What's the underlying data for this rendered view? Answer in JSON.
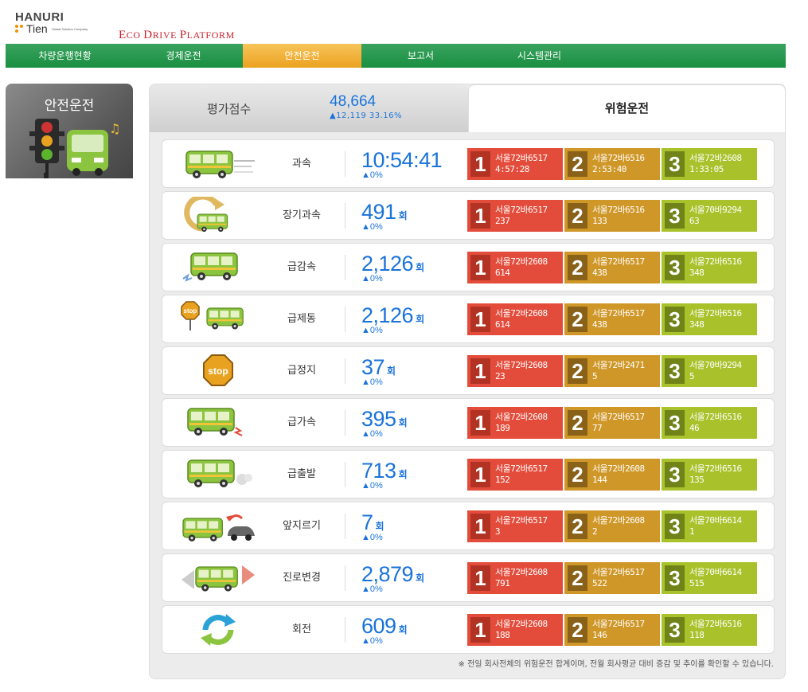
{
  "header": {
    "logo_name": "HANURI",
    "logo_sub": "Tien",
    "logo_tagline": "Global Solution Company",
    "platform_words": [
      {
        "cap": "E",
        "rest": "CO "
      },
      {
        "cap": "D",
        "rest": "RIVE "
      },
      {
        "cap": "P",
        "rest": "LATFORM"
      }
    ]
  },
  "nav": {
    "items": [
      "차량운행현황",
      "경제운전",
      "안전운전",
      "보고서",
      "시스템관리"
    ],
    "active_index": 2
  },
  "sidebar": {
    "title": "안전운전"
  },
  "score_tab": {
    "label": "평가점수",
    "value": "48,664",
    "delta": "▲12,119  33.16%"
  },
  "risk_tab": {
    "label": "위험운전"
  },
  "colors": {
    "accent_blue": "#1a73d9",
    "nav_green": "#198f41",
    "nav_active": "#eba21f",
    "rank1": "#e34c3b",
    "rank2": "#cf9728",
    "rank3": "#a9c12a"
  },
  "rows": [
    {
      "icon": "speeding-bus-icon",
      "name": "과속",
      "value": "10:54:41",
      "unit": "",
      "pct": "▲0%",
      "ranks": [
        {
          "n": "1",
          "plate": "서울72바6517",
          "v": "4:57:28"
        },
        {
          "n": "2",
          "plate": "서울72바6516",
          "v": "2:53:40"
        },
        {
          "n": "3",
          "plate": "서울72바2608",
          "v": "1:33:05"
        }
      ]
    },
    {
      "icon": "long-speeding-bus-icon",
      "name": "장기과속",
      "value": "491",
      "unit": "회",
      "pct": "▲0%",
      "ranks": [
        {
          "n": "1",
          "plate": "서울72바6517",
          "v": "237"
        },
        {
          "n": "2",
          "plate": "서울72바6516",
          "v": "133"
        },
        {
          "n": "3",
          "plate": "서울70바9294",
          "v": "63"
        }
      ]
    },
    {
      "icon": "sudden-decel-bus-icon",
      "name": "급감속",
      "value": "2,126",
      "unit": "회",
      "pct": "▲0%",
      "ranks": [
        {
          "n": "1",
          "plate": "서울72바2608",
          "v": "614"
        },
        {
          "n": "2",
          "plate": "서울72바6517",
          "v": "438"
        },
        {
          "n": "3",
          "plate": "서울72바6516",
          "v": "348"
        }
      ]
    },
    {
      "icon": "sudden-brake-bus-icon",
      "name": "급제동",
      "value": "2,126",
      "unit": "회",
      "pct": "▲0%",
      "ranks": [
        {
          "n": "1",
          "plate": "서울72바2608",
          "v": "614"
        },
        {
          "n": "2",
          "plate": "서울72바6517",
          "v": "438"
        },
        {
          "n": "3",
          "plate": "서울72바6516",
          "v": "348"
        }
      ]
    },
    {
      "icon": "stop-sign-icon",
      "name": "급정지",
      "value": "37",
      "unit": "회",
      "pct": "▲0%",
      "ranks": [
        {
          "n": "1",
          "plate": "서울72바2608",
          "v": "23"
        },
        {
          "n": "2",
          "plate": "서울72바2471",
          "v": "5"
        },
        {
          "n": "3",
          "plate": "서울70바9294",
          "v": "5"
        }
      ]
    },
    {
      "icon": "sudden-accel-bus-icon",
      "name": "급가속",
      "value": "395",
      "unit": "회",
      "pct": "▲0%",
      "ranks": [
        {
          "n": "1",
          "plate": "서울72바2608",
          "v": "189"
        },
        {
          "n": "2",
          "plate": "서울72바6517",
          "v": "77"
        },
        {
          "n": "3",
          "plate": "서울72바6516",
          "v": "46"
        }
      ]
    },
    {
      "icon": "sudden-start-bus-icon",
      "name": "급출발",
      "value": "713",
      "unit": "회",
      "pct": "▲0%",
      "ranks": [
        {
          "n": "1",
          "plate": "서울72바6517",
          "v": "152"
        },
        {
          "n": "2",
          "plate": "서울72바2608",
          "v": "144"
        },
        {
          "n": "3",
          "plate": "서울72바6516",
          "v": "135"
        }
      ]
    },
    {
      "icon": "cut-in-bus-icon",
      "name": "앞지르기",
      "value": "7",
      "unit": "회",
      "pct": "▲0%",
      "ranks": [
        {
          "n": "1",
          "plate": "서울72바6517",
          "v": "3"
        },
        {
          "n": "2",
          "plate": "서울72바2608",
          "v": "2"
        },
        {
          "n": "3",
          "plate": "서울70바6614",
          "v": "1"
        }
      ]
    },
    {
      "icon": "lane-change-bus-icon",
      "name": "진로변경",
      "value": "2,879",
      "unit": "회",
      "pct": "▲0%",
      "ranks": [
        {
          "n": "1",
          "plate": "서울72바2608",
          "v": "791"
        },
        {
          "n": "2",
          "plate": "서울72바6517",
          "v": "522"
        },
        {
          "n": "3",
          "plate": "서울70바6614",
          "v": "515"
        }
      ]
    },
    {
      "icon": "rotation-icon",
      "name": "회전",
      "value": "609",
      "unit": "회",
      "pct": "▲0%",
      "ranks": [
        {
          "n": "1",
          "plate": "서울72바2608",
          "v": "188"
        },
        {
          "n": "2",
          "plate": "서울72바6517",
          "v": "146"
        },
        {
          "n": "3",
          "plate": "서울72바6516",
          "v": "118"
        }
      ]
    }
  ],
  "footnote": "※ 전일 회사전체의 위험운전 합계이며, 전월 회사평균 대비 증감 및 추이를 확인할 수 있습니다."
}
